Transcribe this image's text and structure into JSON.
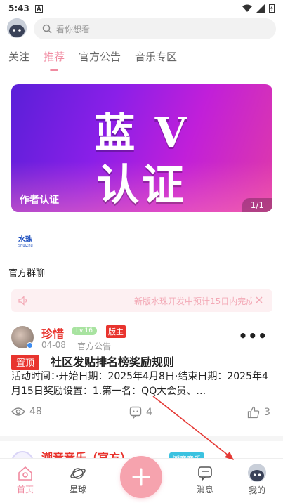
{
  "status": {
    "time": "5:43",
    "a_icon": "A"
  },
  "search": {
    "placeholder": "看你想看"
  },
  "tabs": [
    {
      "label": "关注",
      "active": false
    },
    {
      "label": "推荐",
      "active": true
    },
    {
      "label": "官方公告",
      "active": false
    },
    {
      "label": "音乐专区",
      "active": false
    }
  ],
  "banner": {
    "line1": "蓝 V",
    "line2": "认证",
    "caption": "作者认证",
    "pager": "1/1"
  },
  "group": {
    "logo_text": "水珠",
    "logo_sub": "ShuiZhu",
    "label": "官方群聊"
  },
  "notice": {
    "text": "新版水珠开发中预计15日内完成"
  },
  "post": {
    "author": "珍惜",
    "level": "Lv.16",
    "role": "版主",
    "date": "04-08",
    "category": "官方公告",
    "pin": "置顶",
    "title": "社区发贴排名榜奖励规则",
    "body": "活动时间：·开始日期：2025年4月8日·结束日期：2025年4月15日奖励设置：1.第一名：QQ大会员、…",
    "views": "48",
    "comments": "4",
    "likes": "3"
  },
  "next_post": {
    "author": "潮音音乐（官方）",
    "tag": "潮音音乐"
  },
  "nav": {
    "home": "首页",
    "planet": "星球",
    "messages": "消息",
    "me": "我的"
  },
  "colors": {
    "accent": "#f08aa0",
    "fab": "#f6a3ae",
    "red": "#e8342e"
  }
}
